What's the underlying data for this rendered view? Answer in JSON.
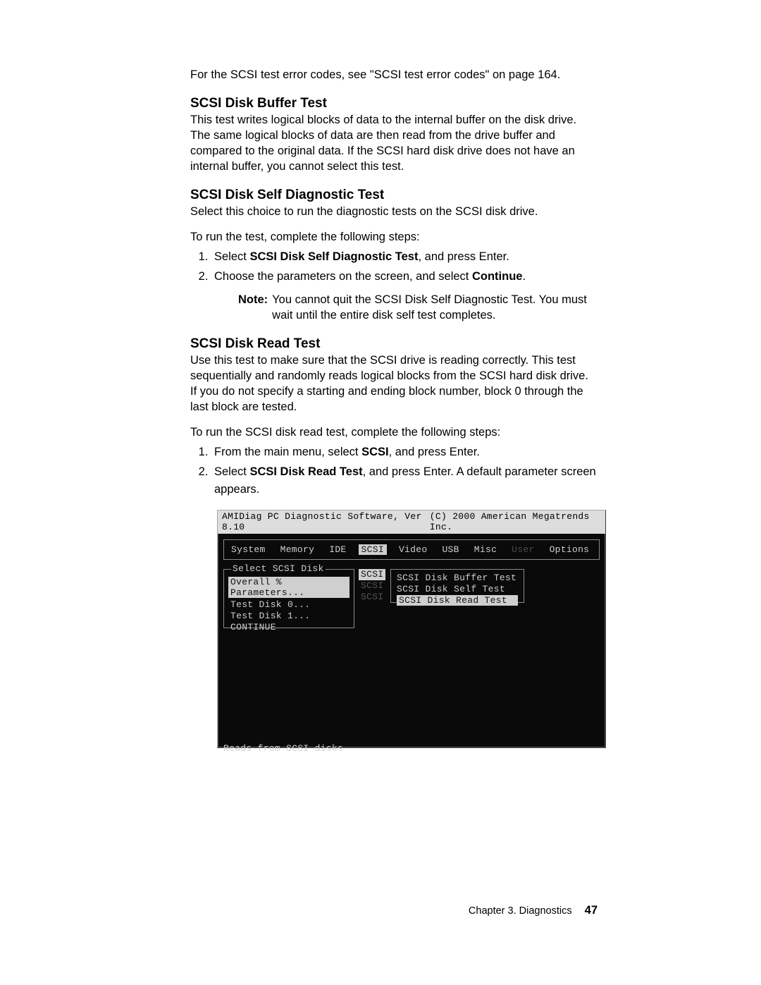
{
  "intro": "For the SCSI test error codes, see \"SCSI test error codes\" on page 164.",
  "section1": {
    "title": "SCSI Disk Buffer Test",
    "body": "This test writes logical blocks of data to the internal buffer on the disk drive. The same logical blocks of data are then read from the drive buffer and compared to the original data. If the SCSI hard disk drive does not have an internal buffer, you cannot select this test."
  },
  "section2": {
    "title": "SCSI Disk Self Diagnostic Test",
    "body1": "Select this choice to run the diagnostic tests on the SCSI disk drive.",
    "body2": "To run the test, complete the following steps:",
    "step1_pre": "Select ",
    "step1_bold": "SCSI Disk Self Diagnostic Test",
    "step1_post": ", and press Enter.",
    "step2_pre": "Choose the parameters on the screen, and select ",
    "step2_bold": "Continue",
    "step2_post": ".",
    "note_label": "Note:",
    "note_body": "You cannot quit the SCSI Disk Self Diagnostic Test. You must wait until the entire disk self test completes."
  },
  "section3": {
    "title": "SCSI Disk Read Test",
    "body1": "Use this test to make sure that the SCSI drive is reading correctly. This test sequentially and randomly reads logical blocks from the SCSI hard disk drive. If you do not specify a starting and ending block number, block 0 through the last block are tested.",
    "body2": "To run the SCSI disk read test, complete the following steps:",
    "step1_pre": "From the main menu, select ",
    "step1_bold": "SCSI",
    "step1_post": ", and press Enter.",
    "step2_pre": "Select ",
    "step2_bold": "SCSI Disk Read Test",
    "step2_post": ", and press Enter. A default parameter screen appears."
  },
  "terminal": {
    "title": "AMIDiag PC Diagnostic Software, Ver 8.10",
    "copyright": "(C) 2000 American Megatrends Inc.",
    "menu": [
      "System",
      "Memory",
      "IDE",
      "SCSI",
      "Video",
      "USB",
      "Misc",
      "User",
      "Options"
    ],
    "menu_selected": "SCSI",
    "menu_dim": "User",
    "left_title": "Select SCSI Disk",
    "left_hi": "Overall % Parameters...",
    "left_rows": [
      "Test Disk 0...",
      "Test Disk 1...",
      "CONTINUE"
    ],
    "tags": [
      "SCSI",
      "SCSI",
      "SCSI"
    ],
    "right_rows": [
      "SCSI Disk Buffer Test",
      "SCSI Disk Self Test"
    ],
    "right_hi": "SCSI Disk Read Test",
    "status": "Reads from SCSI disks"
  },
  "footer": {
    "chapter": "Chapter 3. Diagnostics",
    "page": "47"
  }
}
